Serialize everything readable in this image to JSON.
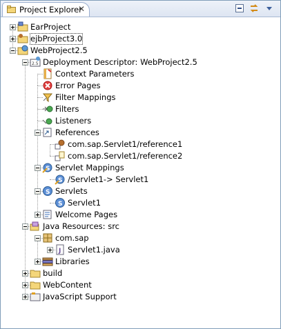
{
  "view": {
    "tab_title": "Project Explorer",
    "close_glyph": "✕",
    "icons": [
      "project-explorer-icon",
      "collapse-all-icon",
      "link-with-editor-icon",
      "view-menu-icon"
    ]
  },
  "tree": {
    "items": [
      {
        "label": "EarProject",
        "icon": "ear-project-icon"
      },
      {
        "label": "ejbProject3.0",
        "icon": "ejb-project-icon"
      },
      {
        "label": "WebProject2.5",
        "icon": "web-project-icon"
      },
      {
        "label": "Deployment Descriptor: WebProject2.5",
        "icon": "deployment-descriptor-icon"
      },
      {
        "label": "Context Parameters",
        "icon": "context-parameters-icon"
      },
      {
        "label": "Error Pages",
        "icon": "error-pages-icon"
      },
      {
        "label": "Filter Mappings",
        "icon": "filter-mappings-icon"
      },
      {
        "label": "Filters",
        "icon": "filters-icon"
      },
      {
        "label": "Listeners",
        "icon": "listeners-icon"
      },
      {
        "label": "References",
        "icon": "references-icon"
      },
      {
        "label": "com.sap.Servlet1/reference1",
        "icon": "ejb-reference-icon"
      },
      {
        "label": "com.sap.Servlet1/reference2",
        "icon": "resource-reference-icon"
      },
      {
        "label": "Servlet Mappings",
        "icon": "servlet-mappings-icon"
      },
      {
        "label": "/Servlet1-> Servlet1",
        "icon": "servlet-mapping-icon"
      },
      {
        "label": "Servlets",
        "icon": "servlets-icon"
      },
      {
        "label": "Servlet1",
        "icon": "servlet-icon"
      },
      {
        "label": "Welcome Pages",
        "icon": "welcome-pages-icon"
      },
      {
        "label": "Java Resources: src",
        "icon": "java-resources-icon"
      },
      {
        "label": "com.sap",
        "icon": "package-icon"
      },
      {
        "label": "Servlet1.java",
        "icon": "java-file-icon"
      },
      {
        "label": "Libraries",
        "icon": "libraries-icon"
      },
      {
        "label": "build",
        "icon": "folder-icon"
      },
      {
        "label": "WebContent",
        "icon": "folder-icon"
      },
      {
        "label": "JavaScript Support",
        "icon": "javascript-support-icon"
      }
    ]
  }
}
